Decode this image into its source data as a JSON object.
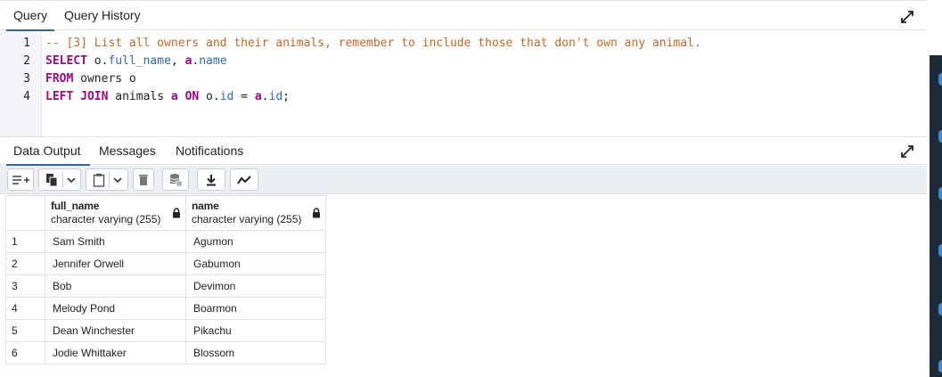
{
  "query_tabs": [
    {
      "label": "Query",
      "active": true
    },
    {
      "label": "Query History",
      "active": false
    }
  ],
  "editor": {
    "line_numbers": [
      "1",
      "2",
      "3",
      "4"
    ],
    "lines": [
      [
        {
          "t": "-- [3] List all owners and their animals, remember to include those that don't own any animal.",
          "c": "cm"
        }
      ],
      [
        {
          "t": "SELECT",
          "c": "kw"
        },
        {
          "t": " o.",
          "c": "pl"
        },
        {
          "t": "full_name",
          "c": "fld"
        },
        {
          "t": ", ",
          "c": "pl"
        },
        {
          "t": "a",
          "c": "kw"
        },
        {
          "t": ".",
          "c": "pl"
        },
        {
          "t": "name",
          "c": "fld"
        }
      ],
      [
        {
          "t": "FROM",
          "c": "kw"
        },
        {
          "t": " owners o",
          "c": "pl"
        }
      ],
      [
        {
          "t": "LEFT JOIN",
          "c": "kw"
        },
        {
          "t": " animals ",
          "c": "pl"
        },
        {
          "t": "a",
          "c": "kw"
        },
        {
          "t": " ",
          "c": "pl"
        },
        {
          "t": "ON",
          "c": "kw"
        },
        {
          "t": " o.",
          "c": "pl"
        },
        {
          "t": "id",
          "c": "fld"
        },
        {
          "t": " = ",
          "c": "pl"
        },
        {
          "t": "a",
          "c": "kw"
        },
        {
          "t": ".",
          "c": "pl"
        },
        {
          "t": "id",
          "c": "fld"
        },
        {
          "t": ";",
          "c": "pl"
        }
      ]
    ]
  },
  "output_tabs": [
    {
      "label": "Data Output",
      "active": true
    },
    {
      "label": "Messages",
      "active": false
    },
    {
      "label": "Notifications",
      "active": false
    }
  ],
  "toolbar_icons": [
    "add-row-icon",
    "copy-icon",
    "chevron-down-icon",
    "paste-icon",
    "chevron-down-icon",
    "delete-icon",
    "save-data-icon",
    "download-icon",
    "graph-icon"
  ],
  "grid": {
    "columns": [
      {
        "name": "full_name",
        "type": "character varying (255)"
      },
      {
        "name": "name",
        "type": "character varying (255)"
      }
    ],
    "rows": [
      {
        "num": "1",
        "cells": [
          "Sam Smith",
          "Agumon"
        ]
      },
      {
        "num": "2",
        "cells": [
          "Jennifer Orwell",
          "Gabumon"
        ]
      },
      {
        "num": "3",
        "cells": [
          "Bob",
          "Devimon"
        ]
      },
      {
        "num": "4",
        "cells": [
          "Melody Pond",
          "Boarmon"
        ]
      },
      {
        "num": "5",
        "cells": [
          "Dean Winchester",
          "Pikachu"
        ]
      },
      {
        "num": "6",
        "cells": [
          "Jodie Whittaker",
          "Blossom"
        ]
      }
    ]
  },
  "colors": {
    "accent": "#326690",
    "keyword": "#a1038b",
    "comment": "#c0682a",
    "field": "#2f6ba8"
  }
}
